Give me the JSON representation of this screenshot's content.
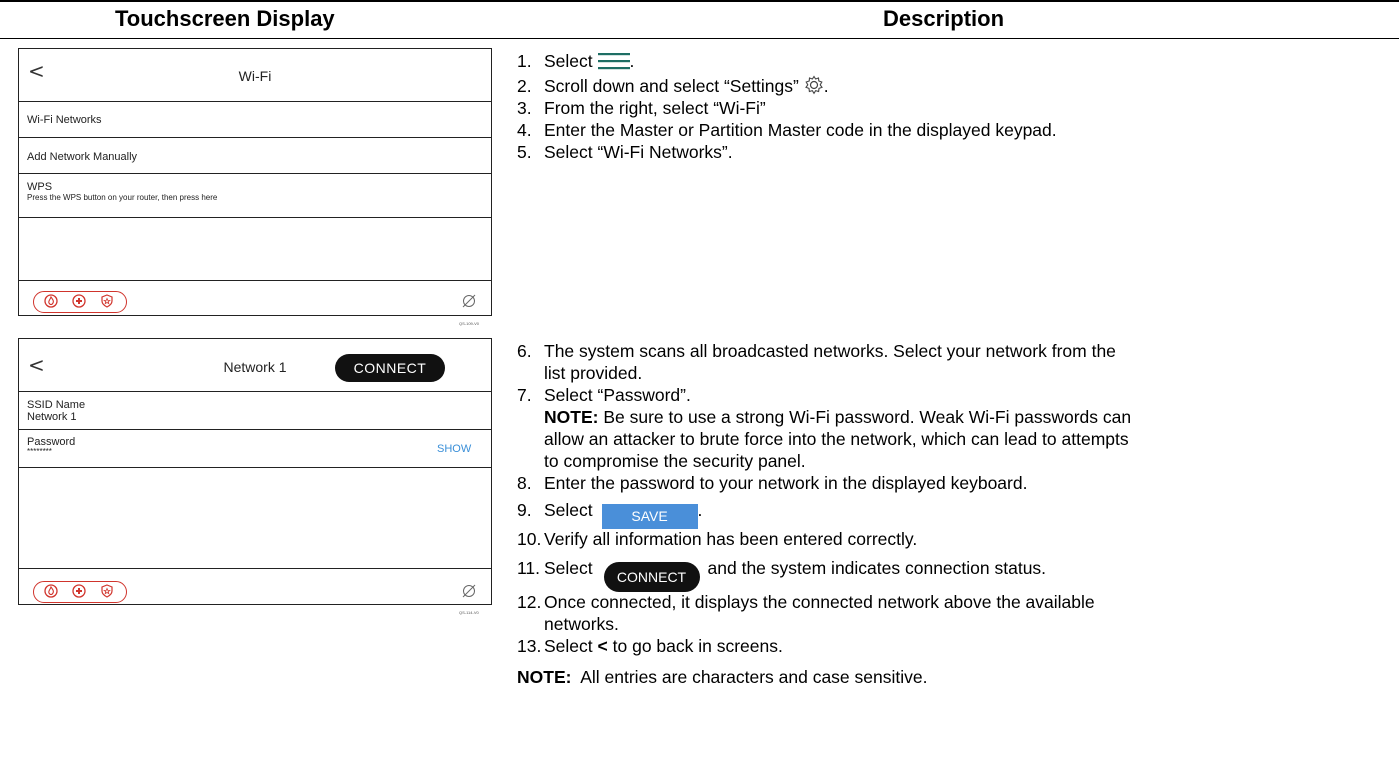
{
  "header": {
    "col1": "Touchscreen Display",
    "col2": "Description"
  },
  "screen1": {
    "back_icon": "<",
    "title": "Wi-Fi",
    "rows": [
      "Wi-Fi Networks",
      "Add Network Manually"
    ],
    "wps_title": "WPS",
    "wps_subtitle": "Press the WPS button on your router, then press here",
    "code": "QS-109-V0"
  },
  "screen2": {
    "back_icon": "<",
    "title": "Network 1",
    "connect": "CONNECT",
    "ssid_label": "SSID Name",
    "ssid_value": "Network 1",
    "password_label": "Password",
    "password_value": "********",
    "show": "SHOW",
    "code": "QS-114-V0"
  },
  "steps": {
    "s1_num": "1.",
    "s1_pre": "Select",
    "s1_post": ".",
    "s2_num": "2.",
    "s2_text": "Scroll down and select “Settings”",
    "s2_post": ".",
    "s3_num": "3.",
    "s3_text": "From the right, select “Wi-Fi”",
    "s4_num": "4.",
    "s4_text": "Enter the Master or Partition Master code in the displayed keypad.",
    "s5_num": "5.",
    "s5_text": "Select “Wi-Fi Networks”.",
    "s6_num": "6.",
    "s6_text": "The system scans all broadcasted networks.  Select your network from the",
    "s6_cont": "list provided.",
    "s7_num": "7.",
    "s7_text": "Select “Password”.",
    "note1_label": "NOTE:",
    "note1_l1": "Be sure to use a strong Wi-Fi password.  Weak Wi-Fi passwords can",
    "note1_l2": "allow an attacker to brute force into the network, which can lead to attempts",
    "note1_l3": "to compromise the security panel.",
    "s8_num": "8.",
    "s8_text": "Enter the password to your network in the displayed keyboard.",
    "s9_num": "9.",
    "s9_pre": "Select",
    "s9_btn": "SAVE",
    "s9_post": ".",
    "s10_num": "10.",
    "s10_text": "Verify all information has been entered correctly.",
    "s11_num": "11.",
    "s11_pre": "Select",
    "s11_btn": "CONNECT",
    "s11_post": "and the system indicates connection status.",
    "s12_num": "12.",
    "s12_text": "Once connected, it displays the connected network above the available",
    "s12_cont": "networks.",
    "s13_num": "13.",
    "s13_pre": "Select",
    "s13_sym": "<",
    "s13_post": "to go back in screens.",
    "note2_label": "NOTE:",
    "note2_text": "All entries are characters and case sensitive."
  },
  "icons": [
    "menu-icon",
    "gear-icon",
    "fire-icon",
    "medical-icon",
    "police-icon",
    "no-signal-icon",
    "back-chevron-icon"
  ],
  "colors": {
    "emergency_red": "#d0342c",
    "save_blue": "#4a8fd9",
    "show_blue": "#3a8fd8",
    "menu_green": "#1e6e64"
  }
}
